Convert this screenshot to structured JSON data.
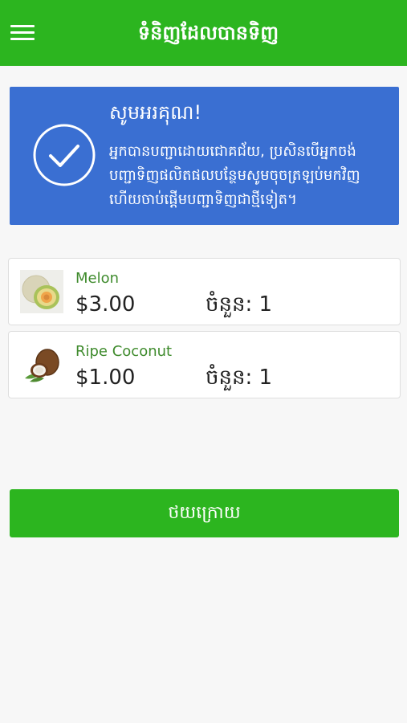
{
  "header": {
    "title": "ទំនិញដែលបានទិញ",
    "menu_icon": "hamburger-menu-icon"
  },
  "confirmation": {
    "title": "សូមអរគុណ!",
    "message": "អ្នកបានបញ្ជាដោយជោគជ័យ, ប្រសិនបើអ្នកចង់បញ្ជាទិញផលិតផលបន្ថែមសូមចុចត្រឡប់មកវិញហើយចាប់ផ្តើមបញ្ជាទិញជាថ្មីទៀត។",
    "icon": "check-circle-icon"
  },
  "order_items": [
    {
      "name": "Melon",
      "price": "$3.00",
      "quantity": "ចំនួន: 1",
      "image_icon": "melon-image"
    },
    {
      "name": "Ripe Coconut",
      "price": "$1.00",
      "quantity": "ចំនួន: 1",
      "image_icon": "coconut-image"
    }
  ],
  "back_button": {
    "label": "ថយក្រោយ"
  },
  "colors": {
    "app_bar": "#2cb51f",
    "card_blue": "#3a6fd2",
    "item_name_green": "#3f8b2d",
    "button_green": "#2cb51f"
  }
}
